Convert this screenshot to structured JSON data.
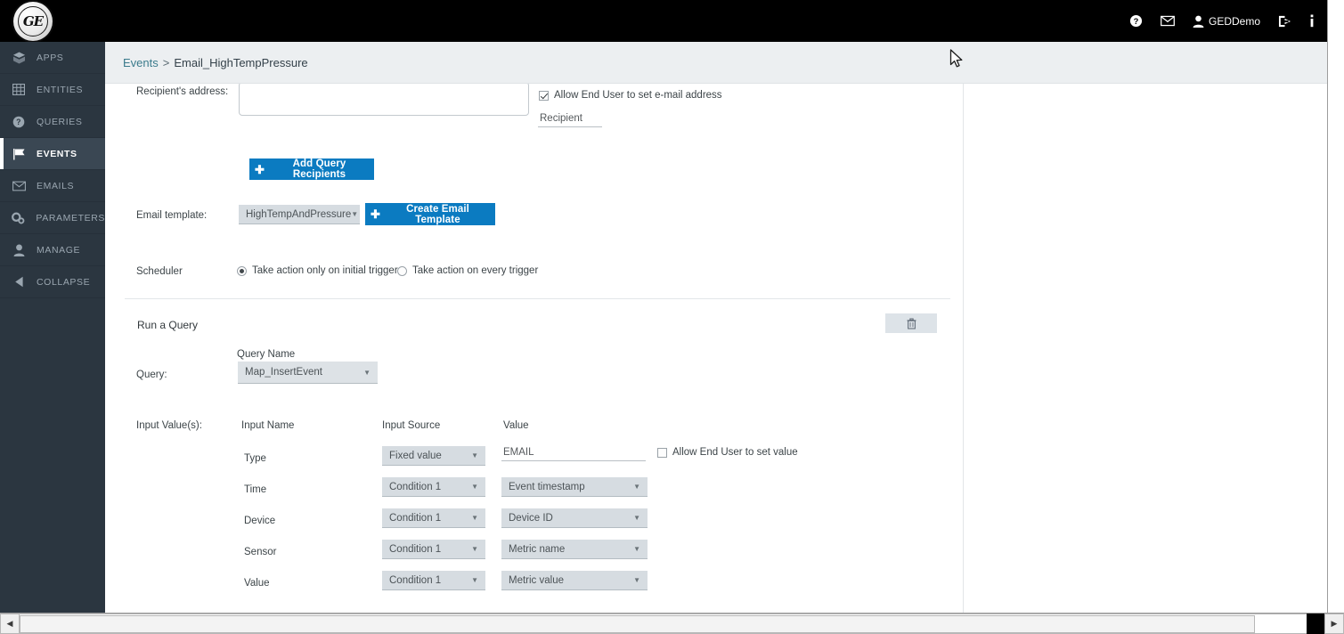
{
  "topbar": {
    "logo_text": "GE",
    "logo_name": "ge-logo",
    "help_icon": "question-circle-icon",
    "mail_icon": "envelope-icon",
    "user_icon": "user-icon",
    "user_name": "GEDDemo",
    "logout_icon": "logout-icon",
    "info_icon": "info-icon"
  },
  "sidebar": {
    "items": [
      {
        "label": "APPS",
        "icon": "apps-box-icon",
        "active": false
      },
      {
        "label": "ENTITIES",
        "icon": "grid-table-icon",
        "active": false
      },
      {
        "label": "QUERIES",
        "icon": "question-circle-icon",
        "active": false
      },
      {
        "label": "EVENTS",
        "icon": "flag-icon",
        "active": true
      },
      {
        "label": "EMAILS",
        "icon": "envelope-icon",
        "active": false
      },
      {
        "label": "PARAMETERS",
        "icon": "gears-icon",
        "active": false
      },
      {
        "label": "MANAGE",
        "icon": "user-icon",
        "active": false
      },
      {
        "label": "COLLAPSE",
        "icon": "chevron-left-icon",
        "active": false
      }
    ]
  },
  "breadcrumb": {
    "parent": "Events",
    "separator": ">",
    "current": "Email_HighTempPressure"
  },
  "email_section": {
    "recipient_label": "Recipient's address:",
    "recipient_value": "",
    "recipient_placeholder": "",
    "allow_enduser_email_label": "Allow End User to set e-mail address",
    "allow_enduser_email_checked": true,
    "recipient_tag_value": "Recipient",
    "add_query_recipients_label": "Add Query Recipients",
    "add_icon": "plus-icon",
    "email_template_label": "Email template:",
    "email_template_value": "HighTempAndPressure",
    "create_email_template_label": "Create Email Template",
    "scheduler_label": "Scheduler",
    "scheduler_option_1": "Take action only on initial trigger",
    "scheduler_option_2": "Take action on every trigger",
    "scheduler_selected": 1
  },
  "query_section": {
    "title": "Run a Query",
    "delete_icon": "trash-icon",
    "query_name_header": "Query Name",
    "query_label": "Query:",
    "query_value": "Map_InsertEvent",
    "input_values_label": "Input Value(s):",
    "columns": {
      "input_name": "Input Name",
      "input_source": "Input Source",
      "value": "Value"
    },
    "rows": [
      {
        "input_name": "Type",
        "input_source": "Fixed value",
        "value": "EMAIL",
        "value_kind": "text",
        "allow_enduser_label": "Allow End User to set value",
        "allow_enduser_checked": false
      },
      {
        "input_name": "Time",
        "input_source": "Condition 1",
        "value": "Event timestamp",
        "value_kind": "select"
      },
      {
        "input_name": "Device",
        "input_source": "Condition 1",
        "value": "Device ID",
        "value_kind": "select"
      },
      {
        "input_name": "Sensor",
        "input_source": "Condition 1",
        "value": "Metric name",
        "value_kind": "select"
      },
      {
        "input_name": "Value",
        "input_source": "Condition 1",
        "value": "Metric value",
        "value_kind": "select"
      }
    ]
  },
  "scrollbars": {
    "left_arrow": "chevron-left-icon",
    "right_arrow": "chevron-right-icon"
  },
  "colors": {
    "accent_blue": "#0b7bc1",
    "sidebar_bg": "#2b3640",
    "topbar_bg": "#000000",
    "breadcrumb_bg": "#eceff1",
    "select_gray": "#d6dce1",
    "link_teal": "#3b7b8c"
  }
}
